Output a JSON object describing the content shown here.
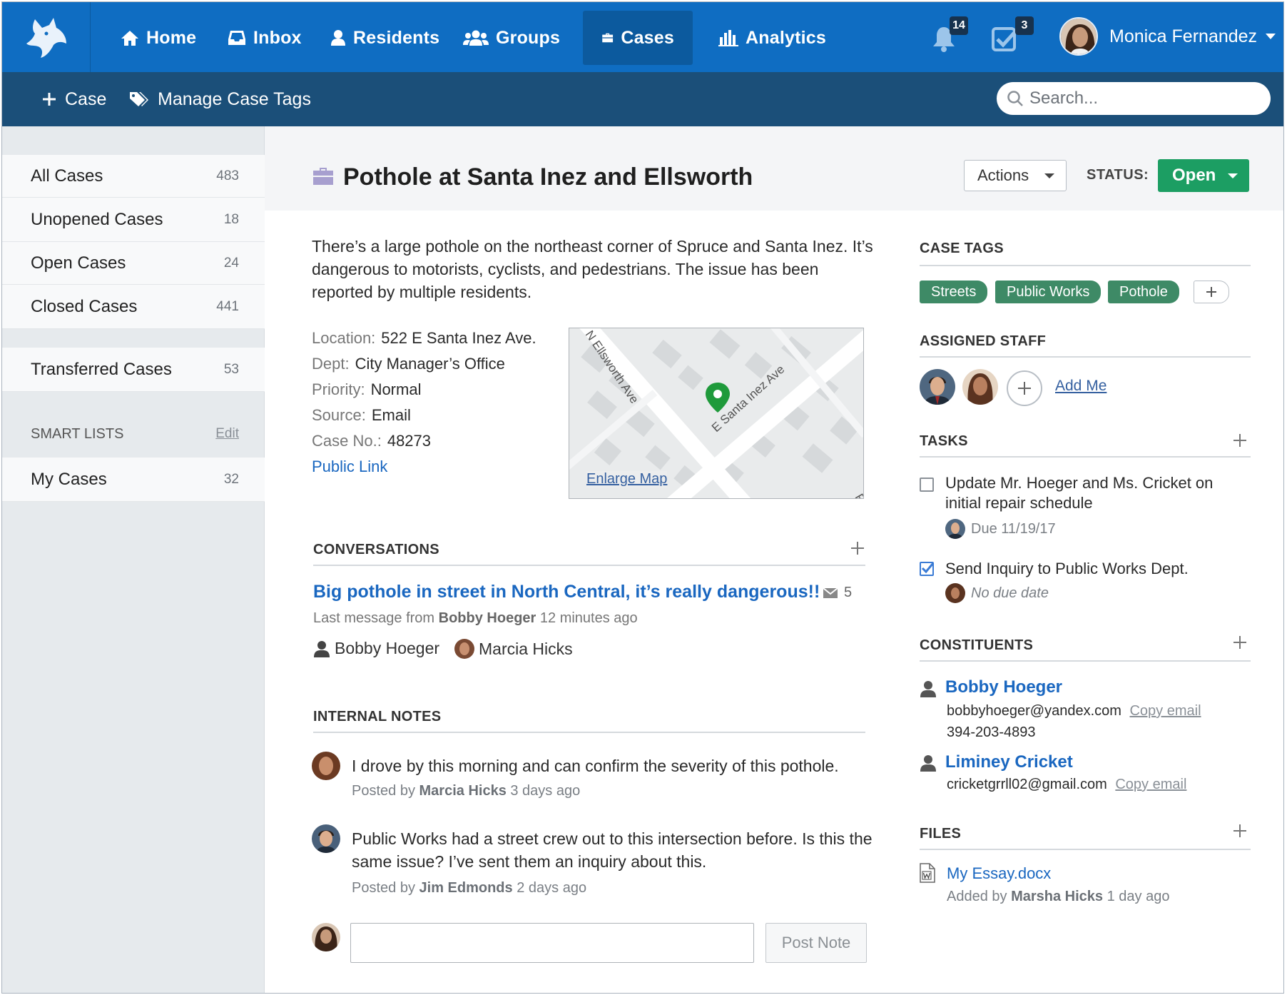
{
  "nav": {
    "items": [
      {
        "label": "Home",
        "icon": "home-icon"
      },
      {
        "label": "Inbox",
        "icon": "inbox-icon"
      },
      {
        "label": "Residents",
        "icon": "person-icon"
      },
      {
        "label": "Groups",
        "icon": "group-icon"
      },
      {
        "label": "Cases",
        "icon": "briefcase-icon",
        "active": true
      },
      {
        "label": "Analytics",
        "icon": "bar-chart-icon"
      }
    ],
    "notifications_count": "14",
    "tasks_count": "3",
    "user_name": "Monica Fernandez"
  },
  "subnav": {
    "new_case": "Case",
    "manage_tags": "Manage Case Tags",
    "search_placeholder": "Search..."
  },
  "sidebar": {
    "items": [
      {
        "label": "All Cases",
        "count": "483"
      },
      {
        "label": "Unopened Cases",
        "count": "18"
      },
      {
        "label": "Open Cases",
        "count": "24"
      },
      {
        "label": "Closed Cases",
        "count": "441"
      },
      {
        "label": "Transferred Cases",
        "count": "53"
      }
    ],
    "smart_lists_heading": "SMART LISTS",
    "smart_lists_edit": "Edit",
    "smart_lists": [
      {
        "label": "My Cases",
        "count": "32"
      }
    ]
  },
  "case": {
    "title": "Pothole at Santa Inez and Ellsworth",
    "actions_label": "Actions",
    "status_label": "STATUS:",
    "status_value": "Open",
    "description": "There’s a large pothole on the northeast corner of Spruce and Santa Inez. It’s dangerous to motorists, cyclists, and pedestrians. The issue has been reported by multiple residents.",
    "details": [
      {
        "label": "Location:",
        "value": "522 E Santa Inez Ave."
      },
      {
        "label": "Dept:",
        "value": "City Manager’s Office"
      },
      {
        "label": "Priority:",
        "value": "Normal"
      },
      {
        "label": "Source:",
        "value": "Email"
      },
      {
        "label": "Case No.:",
        "value": "48273"
      }
    ],
    "public_link": "Public Link",
    "map": {
      "street_1": "N Ellsworth Ave",
      "street_2": "E Santa Inez Ave",
      "edge_label": "R",
      "enlarge": "Enlarge Map"
    }
  },
  "conversations": {
    "heading": "CONVERSATIONS",
    "title": "Big pothole in street in North Central, it’s really dangerous!!",
    "message_count": "5",
    "meta_prefix": "Last message from",
    "meta_author": "Bobby Hoeger",
    "meta_time": "12 minutes ago",
    "participants": [
      "Bobby Hoeger",
      "Marcia Hicks"
    ]
  },
  "notes": {
    "heading": "INTERNAL NOTES",
    "items": [
      {
        "text": "I drove by this morning and can confirm the severity of this pothole.",
        "meta_prefix": "Posted by",
        "author": "Marcia Hicks",
        "time": "3 days ago"
      },
      {
        "text": "Public Works had a street crew out to this intersection before. Is this the same issue? I’ve sent them an inquiry about this.",
        "meta_prefix": "Posted by",
        "author": "Jim Edmonds",
        "time": "2 days ago"
      }
    ],
    "input_value": "",
    "post_label": "Post Note"
  },
  "right": {
    "tags_heading": "CASE TAGS",
    "tags": [
      "Streets",
      "Public Works",
      "Pothole"
    ],
    "staff_heading": "ASSIGNED STAFF",
    "add_me": "Add Me",
    "tasks_heading": "TASKS",
    "tasks": [
      {
        "text": "Update Mr. Hoeger and Ms. Cricket on initial repair schedule",
        "meta": "Due 11/19/17",
        "checked": false
      },
      {
        "text": "Send Inquiry to Public Works Dept.",
        "meta": "No due date",
        "checked": true
      }
    ],
    "constituents_heading": "CONSTITUENTS",
    "constituents": [
      {
        "name": "Bobby Hoeger",
        "email": "bobbyhoeger@yandex.com",
        "phone": "394-203-4893"
      },
      {
        "name": "Liminey Cricket",
        "email": "cricketgrrll02@gmail.com"
      }
    ],
    "copy_email": "Copy email",
    "files_heading": "FILES",
    "file_name": "My Essay.docx",
    "file_meta_prefix": "Added by",
    "file_author": "Marsha Hicks",
    "file_time": "1 day ago"
  },
  "colors": {
    "nav_blue": "#0f6dc2",
    "subnav_blue": "#1b4f79",
    "status_green": "#1c9e63",
    "tag_green": "#3e8a66",
    "link_blue": "#1a67c0"
  }
}
